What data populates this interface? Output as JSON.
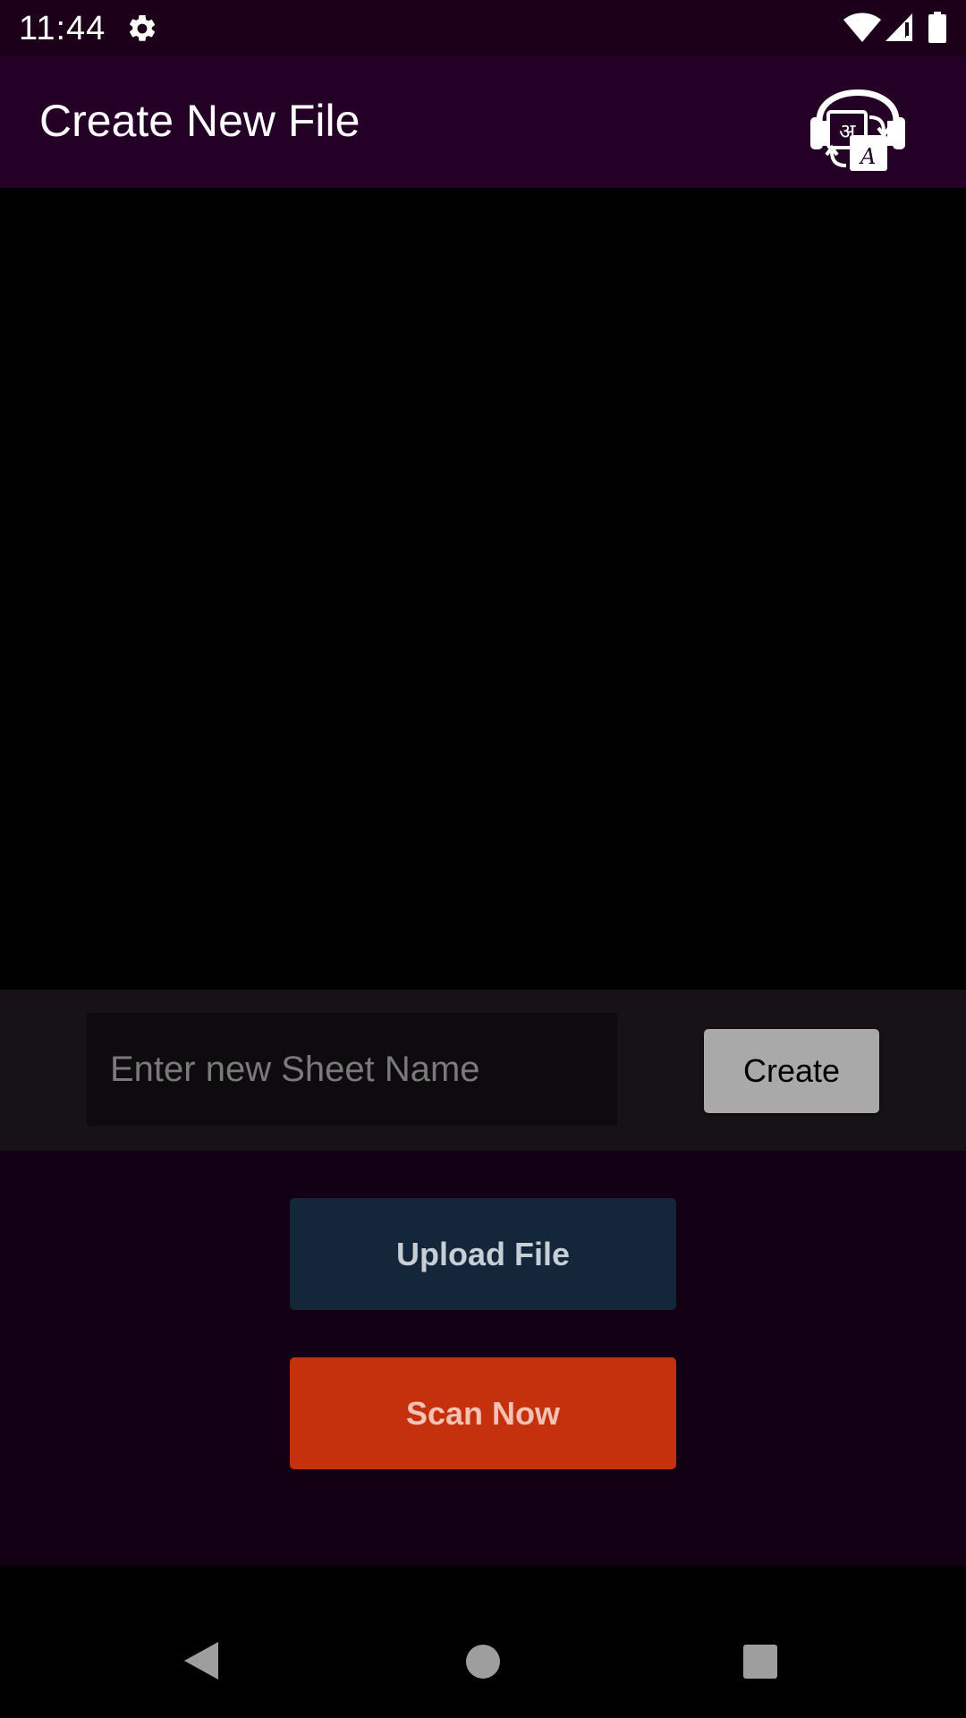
{
  "status_bar": {
    "time": "11:44",
    "icons": [
      "gear-icon",
      "wifi-icon",
      "signal-icon",
      "battery-icon"
    ]
  },
  "app_bar": {
    "title": "Create New File",
    "logo_icon": "headphones-translate-logo"
  },
  "sheet_form": {
    "input_value": "",
    "input_placeholder": "Enter new Sheet Name",
    "create_label": "Create"
  },
  "actions": {
    "upload_label": "Upload File",
    "scan_label": "Scan Now"
  },
  "nav_bar": {
    "icons": [
      "back-icon",
      "home-icon",
      "recents-icon"
    ]
  },
  "colors": {
    "status_bar": "#1c0019",
    "app_bar": "#250026",
    "sheet_panel": "#161216",
    "action_area": "#140014",
    "create_button": "#a9a9a9",
    "upload_button": "#13263a",
    "scan_button": "#c5310c"
  }
}
